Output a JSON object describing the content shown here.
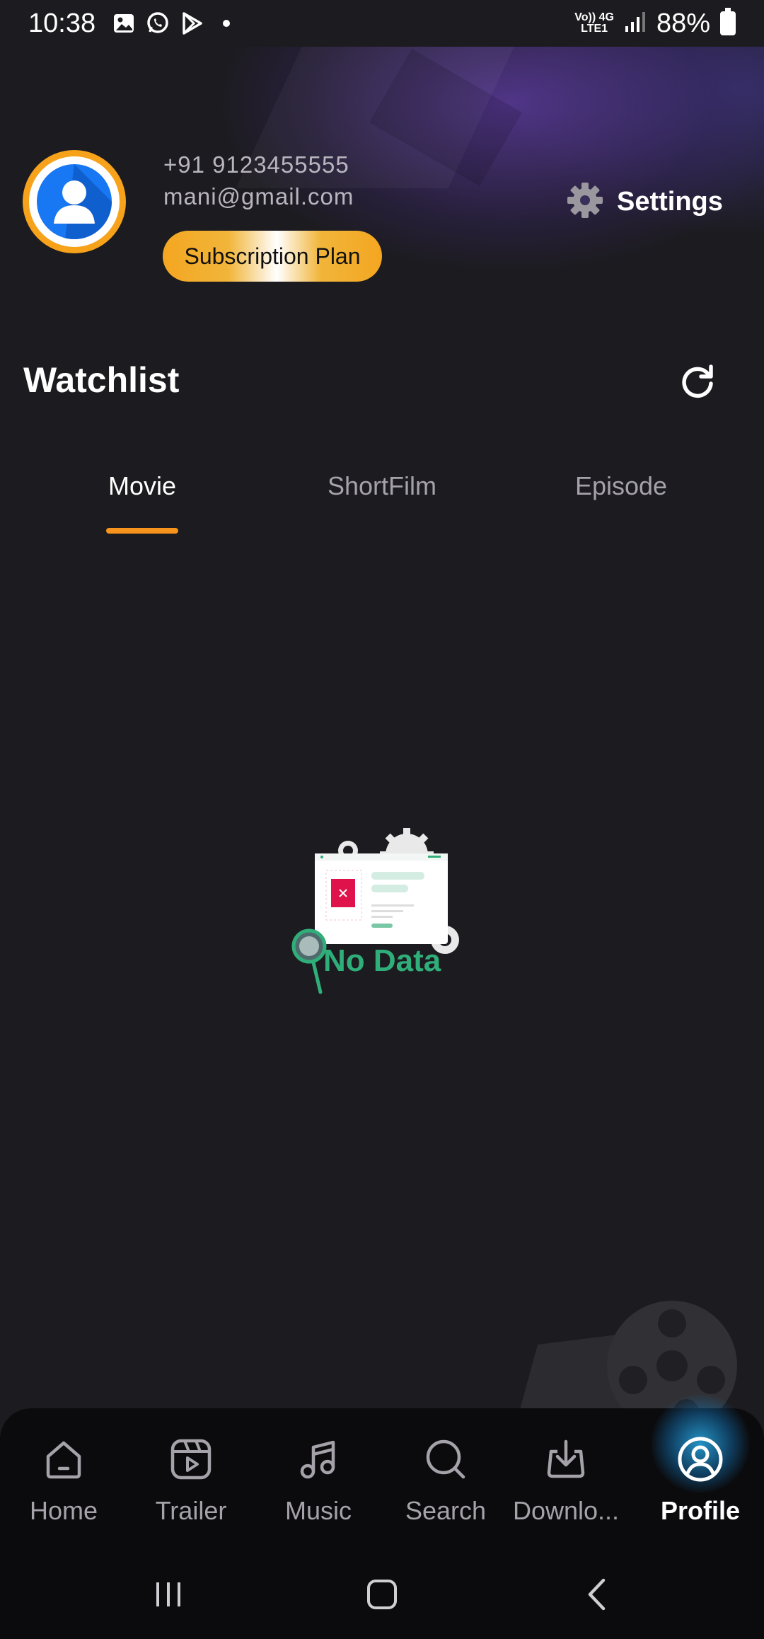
{
  "status_bar": {
    "time": "10:38",
    "network_top": "Vo)) 4G",
    "network_bottom": "LTE1",
    "battery": "88%"
  },
  "profile": {
    "phone": "+91 9123455555",
    "email": "mani@gmail.com",
    "subscription_label": "Subscription Plan",
    "settings_label": "Settings"
  },
  "watchlist": {
    "title": "Watchlist",
    "tabs": [
      {
        "label": "Movie",
        "active": true
      },
      {
        "label": "ShortFilm",
        "active": false
      },
      {
        "label": "Episode",
        "active": false
      }
    ],
    "empty_text": "No Data"
  },
  "bottom_nav": {
    "items": [
      {
        "label": "Home",
        "icon": "home-icon"
      },
      {
        "label": "Trailer",
        "icon": "trailer-icon"
      },
      {
        "label": "Music",
        "icon": "music-icon"
      },
      {
        "label": "Search",
        "icon": "search-icon"
      },
      {
        "label": "Downlo...",
        "icon": "download-icon"
      },
      {
        "label": "Profile",
        "icon": "profile-icon",
        "active": true
      }
    ]
  },
  "colors": {
    "background": "#1c1b1f",
    "accent": "#f7941d",
    "avatar_ring": "#f7a21b",
    "avatar_fill": "#1877f2",
    "empty_state": "#2fae7a",
    "profile_glow": "#28aae6"
  }
}
